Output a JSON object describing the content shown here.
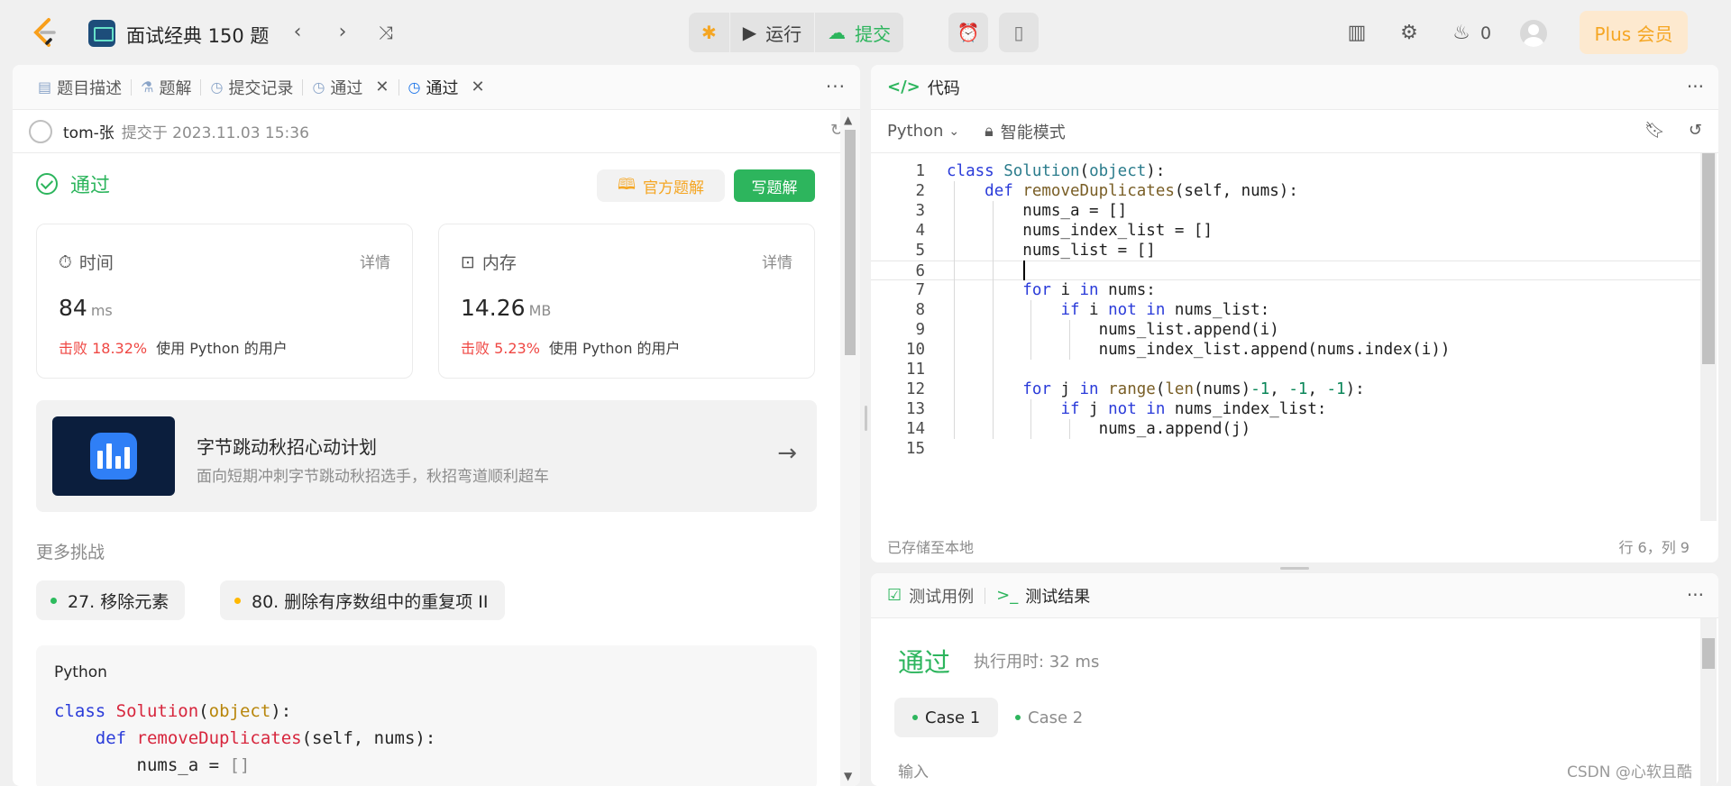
{
  "topbar": {
    "problem_list_title": "面试经典 150 题",
    "run_label": "运行",
    "submit_label": "提交",
    "streak_count": "0",
    "plus_label": "Plus 会员"
  },
  "left": {
    "tabs": [
      {
        "label": "题目描述"
      },
      {
        "label": "题解"
      },
      {
        "label": "提交记录"
      },
      {
        "label": "通过"
      },
      {
        "label": "通过"
      }
    ],
    "submission": {
      "user": "tom-张",
      "submitted_at": "提交于 2023.11.03 15:36"
    },
    "status": "通过",
    "official_solution_label": "官方题解",
    "write_solution_label": "写题解",
    "time": {
      "label": "时间",
      "detail": "详情",
      "value": "84",
      "unit": "ms",
      "beat": "击败 18.32%",
      "beat_suffix": "使用 Python 的用户"
    },
    "memory": {
      "label": "内存",
      "detail": "详情",
      "value": "14.26",
      "unit": "MB",
      "beat": "击败 5.23%",
      "beat_suffix": "使用 Python 的用户"
    },
    "promo": {
      "title": "字节跳动秋招心动计划",
      "subtitle": "面向短期冲刺字节跳动秋招选手，秋招弯道顺利超车"
    },
    "more_challenges_title": "更多挑战",
    "challenges": [
      {
        "label": "27. 移除元素",
        "color": "#2cbb5d"
      },
      {
        "label": "80. 删除有序数组中的重复项 II",
        "color": "#ffb800"
      }
    ],
    "code_card": {
      "lang": "Python",
      "lines": [
        "class Solution(object):",
        "    def removeDuplicates(self, nums):",
        "        nums_a = []"
      ]
    }
  },
  "code_panel": {
    "tab_label": "代码",
    "language": "Python",
    "mode": "智能模式",
    "lines": [
      {
        "n": "1",
        "t": "class Solution(object):"
      },
      {
        "n": "2",
        "t": "    def removeDuplicates(self, nums):"
      },
      {
        "n": "3",
        "t": "        nums_a = []"
      },
      {
        "n": "4",
        "t": "        nums_index_list = []"
      },
      {
        "n": "5",
        "t": "        nums_list = []"
      },
      {
        "n": "6",
        "t": ""
      },
      {
        "n": "7",
        "t": "        for i in nums:"
      },
      {
        "n": "8",
        "t": "            if i not in nums_list:"
      },
      {
        "n": "9",
        "t": "                nums_list.append(i)"
      },
      {
        "n": "10",
        "t": "                nums_index_list.append(nums.index(i))"
      },
      {
        "n": "11",
        "t": ""
      },
      {
        "n": "12",
        "t": "        for j in range(len(nums)-1, -1, -1):"
      },
      {
        "n": "13",
        "t": "            if j not in nums_index_list:"
      },
      {
        "n": "14",
        "t": "                nums_a.append(j)"
      },
      {
        "n": "15",
        "t": ""
      }
    ],
    "saved_status": "已存储至本地",
    "cursor_position": "行 6，列 9"
  },
  "test_panel": {
    "tabs": [
      {
        "label": "测试用例"
      },
      {
        "label": "测试结果"
      }
    ],
    "result": "通过",
    "exec_time": "执行用时: 32 ms",
    "cases": [
      {
        "label": "Case 1"
      },
      {
        "label": "Case 2"
      }
    ],
    "input_label": "输入"
  },
  "watermark": "CSDN @心软且酷"
}
